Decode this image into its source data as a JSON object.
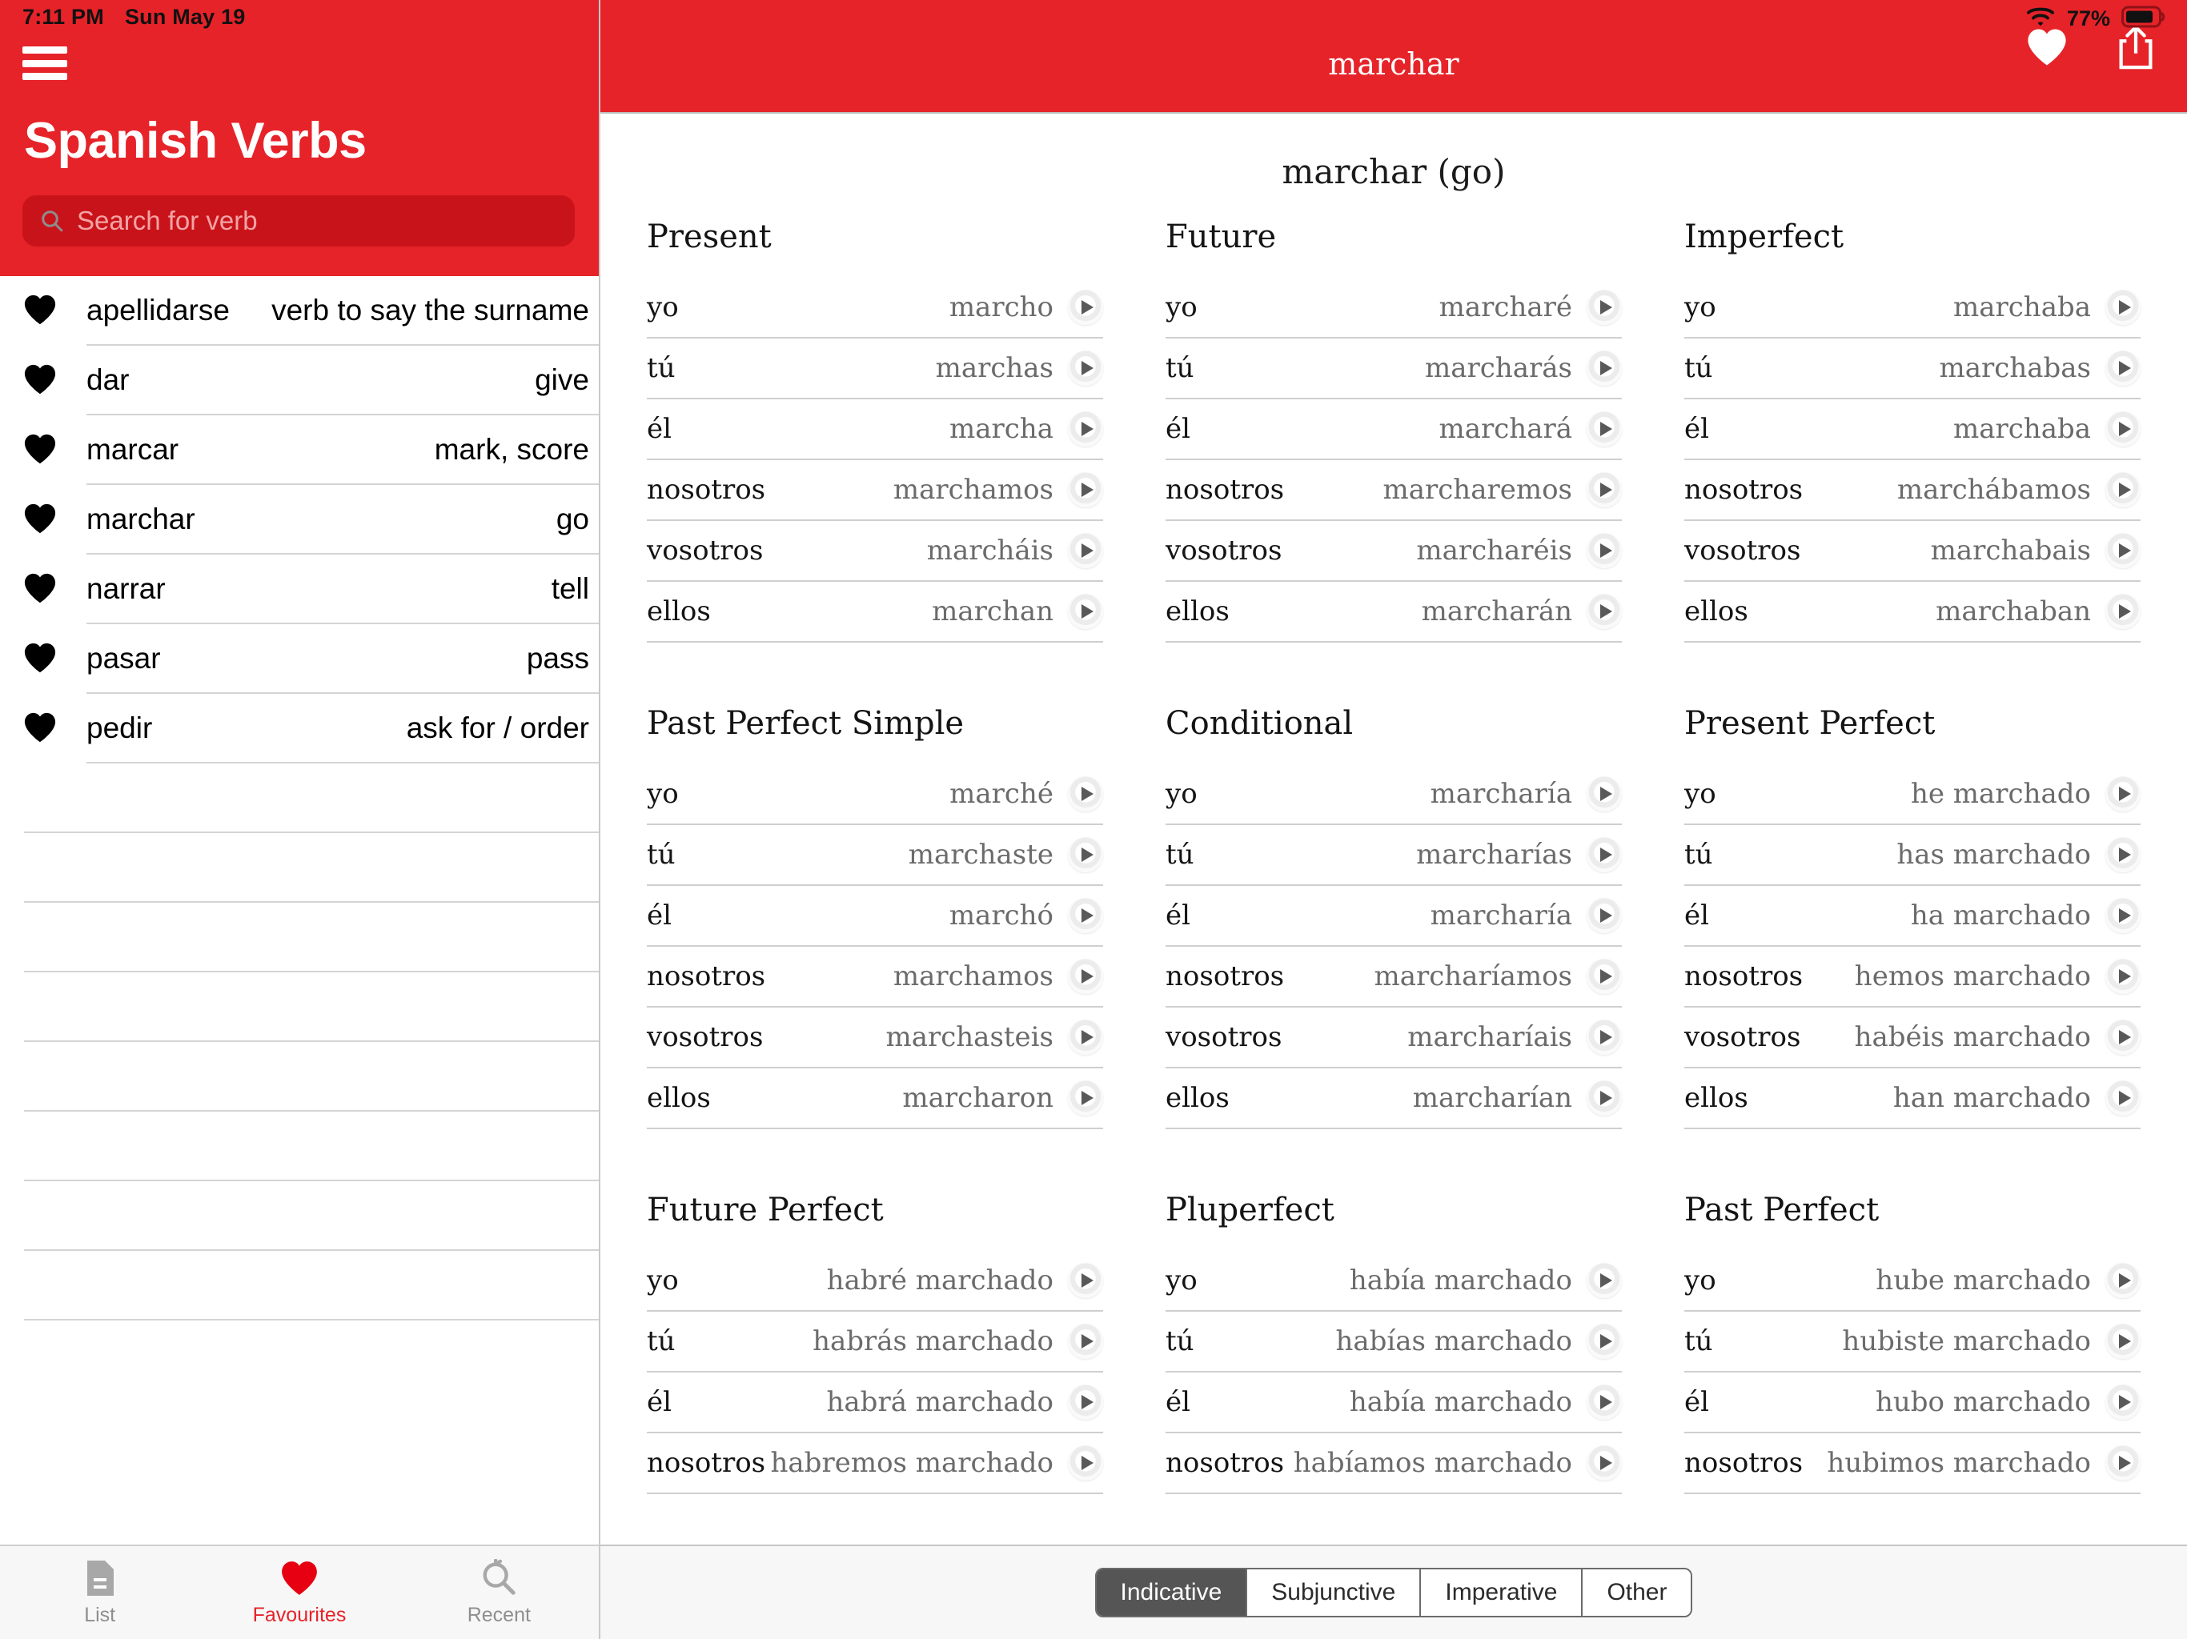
{
  "status_bar": {
    "time": "7:11 PM",
    "date": "Sun May 19",
    "battery_percent": "77%",
    "wifi_icon": "wifi-icon",
    "battery_icon": "battery-icon"
  },
  "sidebar": {
    "menu_icon": "hamburger-menu-icon",
    "app_title": "Spanish Verbs",
    "search": {
      "icon": "search-icon",
      "placeholder": "Search for verb",
      "value": ""
    },
    "verbs": [
      {
        "heart": "heart-icon",
        "name": "apellidarse",
        "translation": "verb to say the surname"
      },
      {
        "heart": "heart-icon",
        "name": "dar",
        "translation": "give"
      },
      {
        "heart": "heart-icon",
        "name": "marcar",
        "translation": "mark, score"
      },
      {
        "heart": "heart-icon",
        "name": "marchar",
        "translation": "go"
      },
      {
        "heart": "heart-icon",
        "name": "narrar",
        "translation": "tell"
      },
      {
        "heart": "heart-icon",
        "name": "pasar",
        "translation": "pass"
      },
      {
        "heart": "heart-icon",
        "name": "pedir",
        "translation": "ask for / order"
      }
    ],
    "empty_row_count": 8,
    "tabs": [
      {
        "label": "List",
        "icon": "document-icon",
        "active": false
      },
      {
        "label": "Favourites",
        "icon": "heart-icon",
        "active": true
      },
      {
        "label": "Recent",
        "icon": "recent-search-icon",
        "active": false
      }
    ]
  },
  "navbar": {
    "title": "marchar",
    "favourite_icon": "heart-icon",
    "share_icon": "share-icon"
  },
  "main": {
    "verb_heading": "marchar (go)",
    "play_icon": "play-icon",
    "tenses": [
      {
        "title": "Present",
        "rows": [
          {
            "pronoun": "yo",
            "form": "marcho"
          },
          {
            "pronoun": "tú",
            "form": "marchas"
          },
          {
            "pronoun": "él",
            "form": "marcha"
          },
          {
            "pronoun": "nosotros",
            "form": "marchamos"
          },
          {
            "pronoun": "vosotros",
            "form": "marcháis"
          },
          {
            "pronoun": "ellos",
            "form": "marchan"
          }
        ]
      },
      {
        "title": "Future",
        "rows": [
          {
            "pronoun": "yo",
            "form": "marcharé"
          },
          {
            "pronoun": "tú",
            "form": "marcharás"
          },
          {
            "pronoun": "él",
            "form": "marchará"
          },
          {
            "pronoun": "nosotros",
            "form": "marcharemos"
          },
          {
            "pronoun": "vosotros",
            "form": "marcharéis"
          },
          {
            "pronoun": "ellos",
            "form": "marcharán"
          }
        ]
      },
      {
        "title": "Imperfect",
        "rows": [
          {
            "pronoun": "yo",
            "form": "marchaba"
          },
          {
            "pronoun": "tú",
            "form": "marchabas"
          },
          {
            "pronoun": "él",
            "form": "marchaba"
          },
          {
            "pronoun": "nosotros",
            "form": "marchábamos"
          },
          {
            "pronoun": "vosotros",
            "form": "marchabais"
          },
          {
            "pronoun": "ellos",
            "form": "marchaban"
          }
        ]
      },
      {
        "title": "Past Perfect Simple",
        "rows": [
          {
            "pronoun": "yo",
            "form": "marché"
          },
          {
            "pronoun": "tú",
            "form": "marchaste"
          },
          {
            "pronoun": "él",
            "form": "marchó"
          },
          {
            "pronoun": "nosotros",
            "form": "marchamos"
          },
          {
            "pronoun": "vosotros",
            "form": "marchasteis"
          },
          {
            "pronoun": "ellos",
            "form": "marcharon"
          }
        ]
      },
      {
        "title": "Conditional",
        "rows": [
          {
            "pronoun": "yo",
            "form": "marcharía"
          },
          {
            "pronoun": "tú",
            "form": "marcharías"
          },
          {
            "pronoun": "él",
            "form": "marcharía"
          },
          {
            "pronoun": "nosotros",
            "form": "marcharíamos"
          },
          {
            "pronoun": "vosotros",
            "form": "marcharíais"
          },
          {
            "pronoun": "ellos",
            "form": "marcharían"
          }
        ]
      },
      {
        "title": "Present Perfect",
        "rows": [
          {
            "pronoun": "yo",
            "form": "he marchado"
          },
          {
            "pronoun": "tú",
            "form": "has marchado"
          },
          {
            "pronoun": "él",
            "form": "ha marchado"
          },
          {
            "pronoun": "nosotros",
            "form": "hemos marchado"
          },
          {
            "pronoun": "vosotros",
            "form": "habéis marchado"
          },
          {
            "pronoun": "ellos",
            "form": "han marchado"
          }
        ]
      },
      {
        "title": "Future Perfect",
        "rows": [
          {
            "pronoun": "yo",
            "form": "habré marchado"
          },
          {
            "pronoun": "tú",
            "form": "habrás marchado"
          },
          {
            "pronoun": "él",
            "form": "habrá marchado"
          },
          {
            "pronoun": "nosotros",
            "form": "habremos marchado"
          }
        ]
      },
      {
        "title": "Pluperfect",
        "rows": [
          {
            "pronoun": "yo",
            "form": "había marchado"
          },
          {
            "pronoun": "tú",
            "form": "habías marchado"
          },
          {
            "pronoun": "él",
            "form": "había marchado"
          },
          {
            "pronoun": "nosotros",
            "form": "habíamos marchado"
          }
        ]
      },
      {
        "title": "Past Perfect",
        "rows": [
          {
            "pronoun": "yo",
            "form": "hube marchado"
          },
          {
            "pronoun": "tú",
            "form": "hubiste marchado"
          },
          {
            "pronoun": "él",
            "form": "hubo marchado"
          },
          {
            "pronoun": "nosotros",
            "form": "hubimos marchado"
          }
        ]
      }
    ],
    "mood_segments": [
      {
        "label": "Indicative",
        "selected": true
      },
      {
        "label": "Subjunctive",
        "selected": false
      },
      {
        "label": "Imperative",
        "selected": false
      },
      {
        "label": "Other",
        "selected": false
      }
    ]
  },
  "colors": {
    "brand_red": "#e62329",
    "search_field": "#c9131a",
    "segment_selected": "#555555"
  }
}
